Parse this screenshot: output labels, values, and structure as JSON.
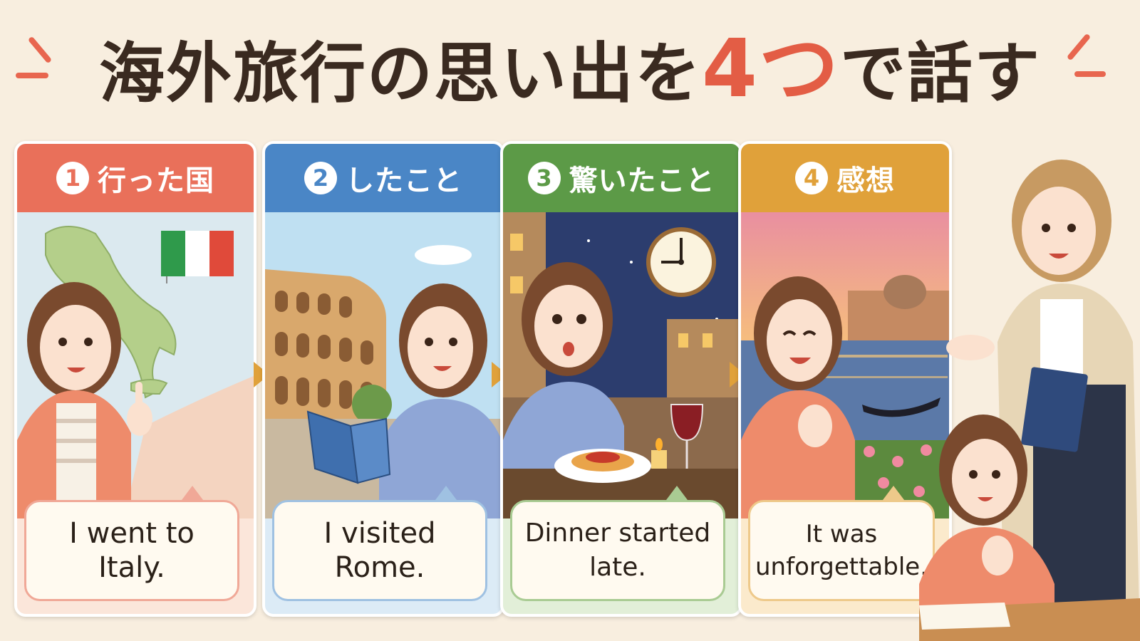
{
  "title": {
    "part1": "海外旅行の思い出を",
    "highlight": "4つ",
    "part2": "で話す"
  },
  "colors": {
    "card1": "#e9705a",
    "card2": "#4a86c6",
    "card3": "#5c9a47",
    "card4": "#e0a13a",
    "accent": "#e35d45"
  },
  "cards": [
    {
      "num": "1",
      "label": "行った国",
      "sentence": "I went to Italy.",
      "icons": [
        "italy-map",
        "italian-flag",
        "woman-pointing"
      ]
    },
    {
      "num": "2",
      "label": "したこと",
      "sentence": "I visited Rome.",
      "icons": [
        "colosseum",
        "guidebook",
        "woman-reading"
      ]
    },
    {
      "num": "3",
      "label": "驚いたこと",
      "sentence": "Dinner started late.",
      "icons": [
        "clock",
        "night-street",
        "spaghetti",
        "wine-glass",
        "candle"
      ]
    },
    {
      "num": "4",
      "label": "感想",
      "sentence": "It was unforgettable.",
      "icons": [
        "venice-sunset",
        "gondola",
        "flowers",
        "woman-happy"
      ]
    }
  ],
  "illustration": {
    "icons": [
      "teacher",
      "student",
      "notebook",
      "desk"
    ]
  }
}
